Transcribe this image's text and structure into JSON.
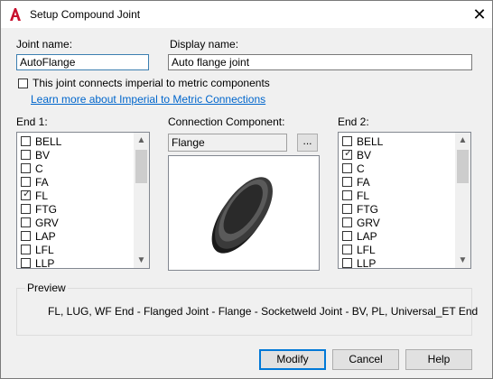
{
  "window": {
    "title": "Setup Compound Joint"
  },
  "joint_name": {
    "label": "Joint name:",
    "value": "AutoFlange"
  },
  "display_name": {
    "label": "Display name:",
    "value": "Auto flange joint"
  },
  "imperial_checkbox": {
    "label": "This joint connects imperial to metric components",
    "checked": false
  },
  "learn_more_link": "Learn more about Imperial to Metric Connections",
  "end1": {
    "label": "End 1:",
    "items": [
      {
        "label": "BELL",
        "checked": false
      },
      {
        "label": "BV",
        "checked": false
      },
      {
        "label": "C",
        "checked": false
      },
      {
        "label": "FA",
        "checked": false
      },
      {
        "label": "FL",
        "checked": true
      },
      {
        "label": "FTG",
        "checked": false
      },
      {
        "label": "GRV",
        "checked": false
      },
      {
        "label": "LAP",
        "checked": false
      },
      {
        "label": "LFL",
        "checked": false
      },
      {
        "label": "LLP",
        "checked": false
      }
    ]
  },
  "connection_component": {
    "label": "Connection Component:",
    "value": "Flange",
    "browse_label": "..."
  },
  "end2": {
    "label": "End 2:",
    "items": [
      {
        "label": "BELL",
        "checked": false
      },
      {
        "label": "BV",
        "checked": true
      },
      {
        "label": "C",
        "checked": false
      },
      {
        "label": "FA",
        "checked": false
      },
      {
        "label": "FL",
        "checked": false
      },
      {
        "label": "FTG",
        "checked": false
      },
      {
        "label": "GRV",
        "checked": false
      },
      {
        "label": "LAP",
        "checked": false
      },
      {
        "label": "LFL",
        "checked": false
      },
      {
        "label": "LLP",
        "checked": false
      }
    ]
  },
  "preview": {
    "label": "Preview",
    "text": "FL, LUG, WF End - Flanged Joint - Flange - Socketweld Joint - BV, PL, Universal_ET End"
  },
  "buttons": {
    "modify": "Modify",
    "cancel": "Cancel",
    "help": "Help"
  },
  "colors": {
    "link": "#0066cc",
    "default_button_border": "#0078d7",
    "app_icon": "#c8102e"
  },
  "icons": {
    "app": "autocad-a-icon",
    "close": "close-icon",
    "check": "check-icon",
    "scroll_up": "chevron-up-icon",
    "scroll_down": "chevron-down-icon"
  }
}
